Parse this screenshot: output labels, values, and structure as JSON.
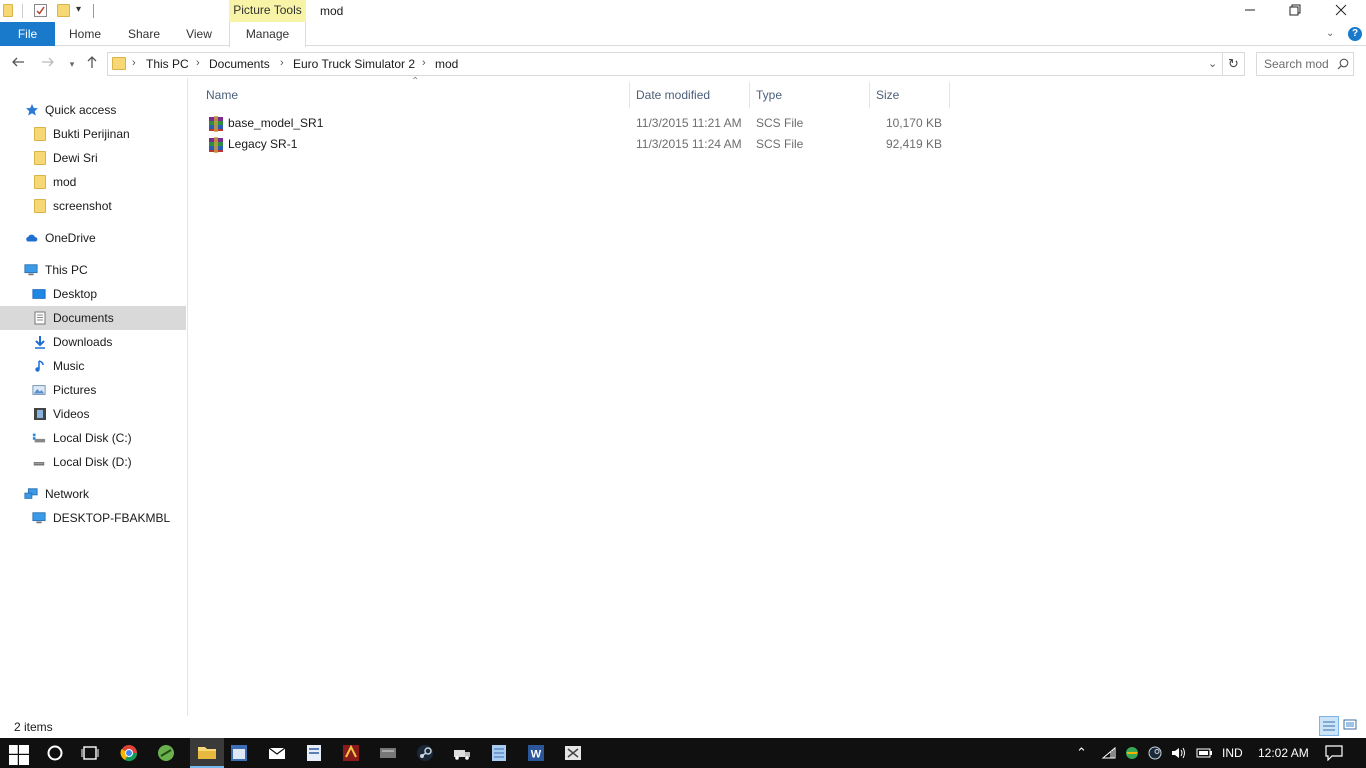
{
  "window": {
    "title": "mod",
    "context_tab": "Picture Tools",
    "minimize": "—",
    "restore": "❐",
    "close": "✕"
  },
  "ribbon": {
    "tabs": [
      "File",
      "Home",
      "Share",
      "View",
      "Manage"
    ],
    "help": "?"
  },
  "address": {
    "crumbs": [
      "This PC",
      "Documents",
      "Euro Truck Simulator 2",
      "mod"
    ],
    "search_placeholder": "Search mod"
  },
  "sidebar": {
    "quick_access": "Quick access",
    "pinned": [
      "Bukti Perijinan",
      "Dewi Sri",
      "mod",
      "screenshot"
    ],
    "onedrive": "OneDrive",
    "this_pc": "This PC",
    "pc_items": [
      "Desktop",
      "Documents",
      "Downloads",
      "Music",
      "Pictures",
      "Videos",
      "Local Disk (C:)",
      "Local Disk (D:)"
    ],
    "network": "Network",
    "network_items": [
      "DESKTOP-FBAKMBL"
    ],
    "selected": "Documents"
  },
  "filelist": {
    "columns": [
      "Name",
      "Date modified",
      "Type",
      "Size"
    ],
    "rows": [
      {
        "name": "base_model_SR1",
        "date": "11/3/2015 11:21 AM",
        "type": "SCS File",
        "size": "10,170 KB"
      },
      {
        "name": "Legacy SR-1",
        "date": "11/3/2015 11:24 AM",
        "type": "SCS File",
        "size": "92,419 KB"
      }
    ]
  },
  "status": {
    "items": "2 items"
  },
  "taskbar": {
    "lang": "IND",
    "time": "12:02 AM"
  },
  "colors": {
    "accent": "#1979ca",
    "selection": "#d9d9d9",
    "context_tab": "#f7f4a8",
    "taskbar": "#101010"
  }
}
